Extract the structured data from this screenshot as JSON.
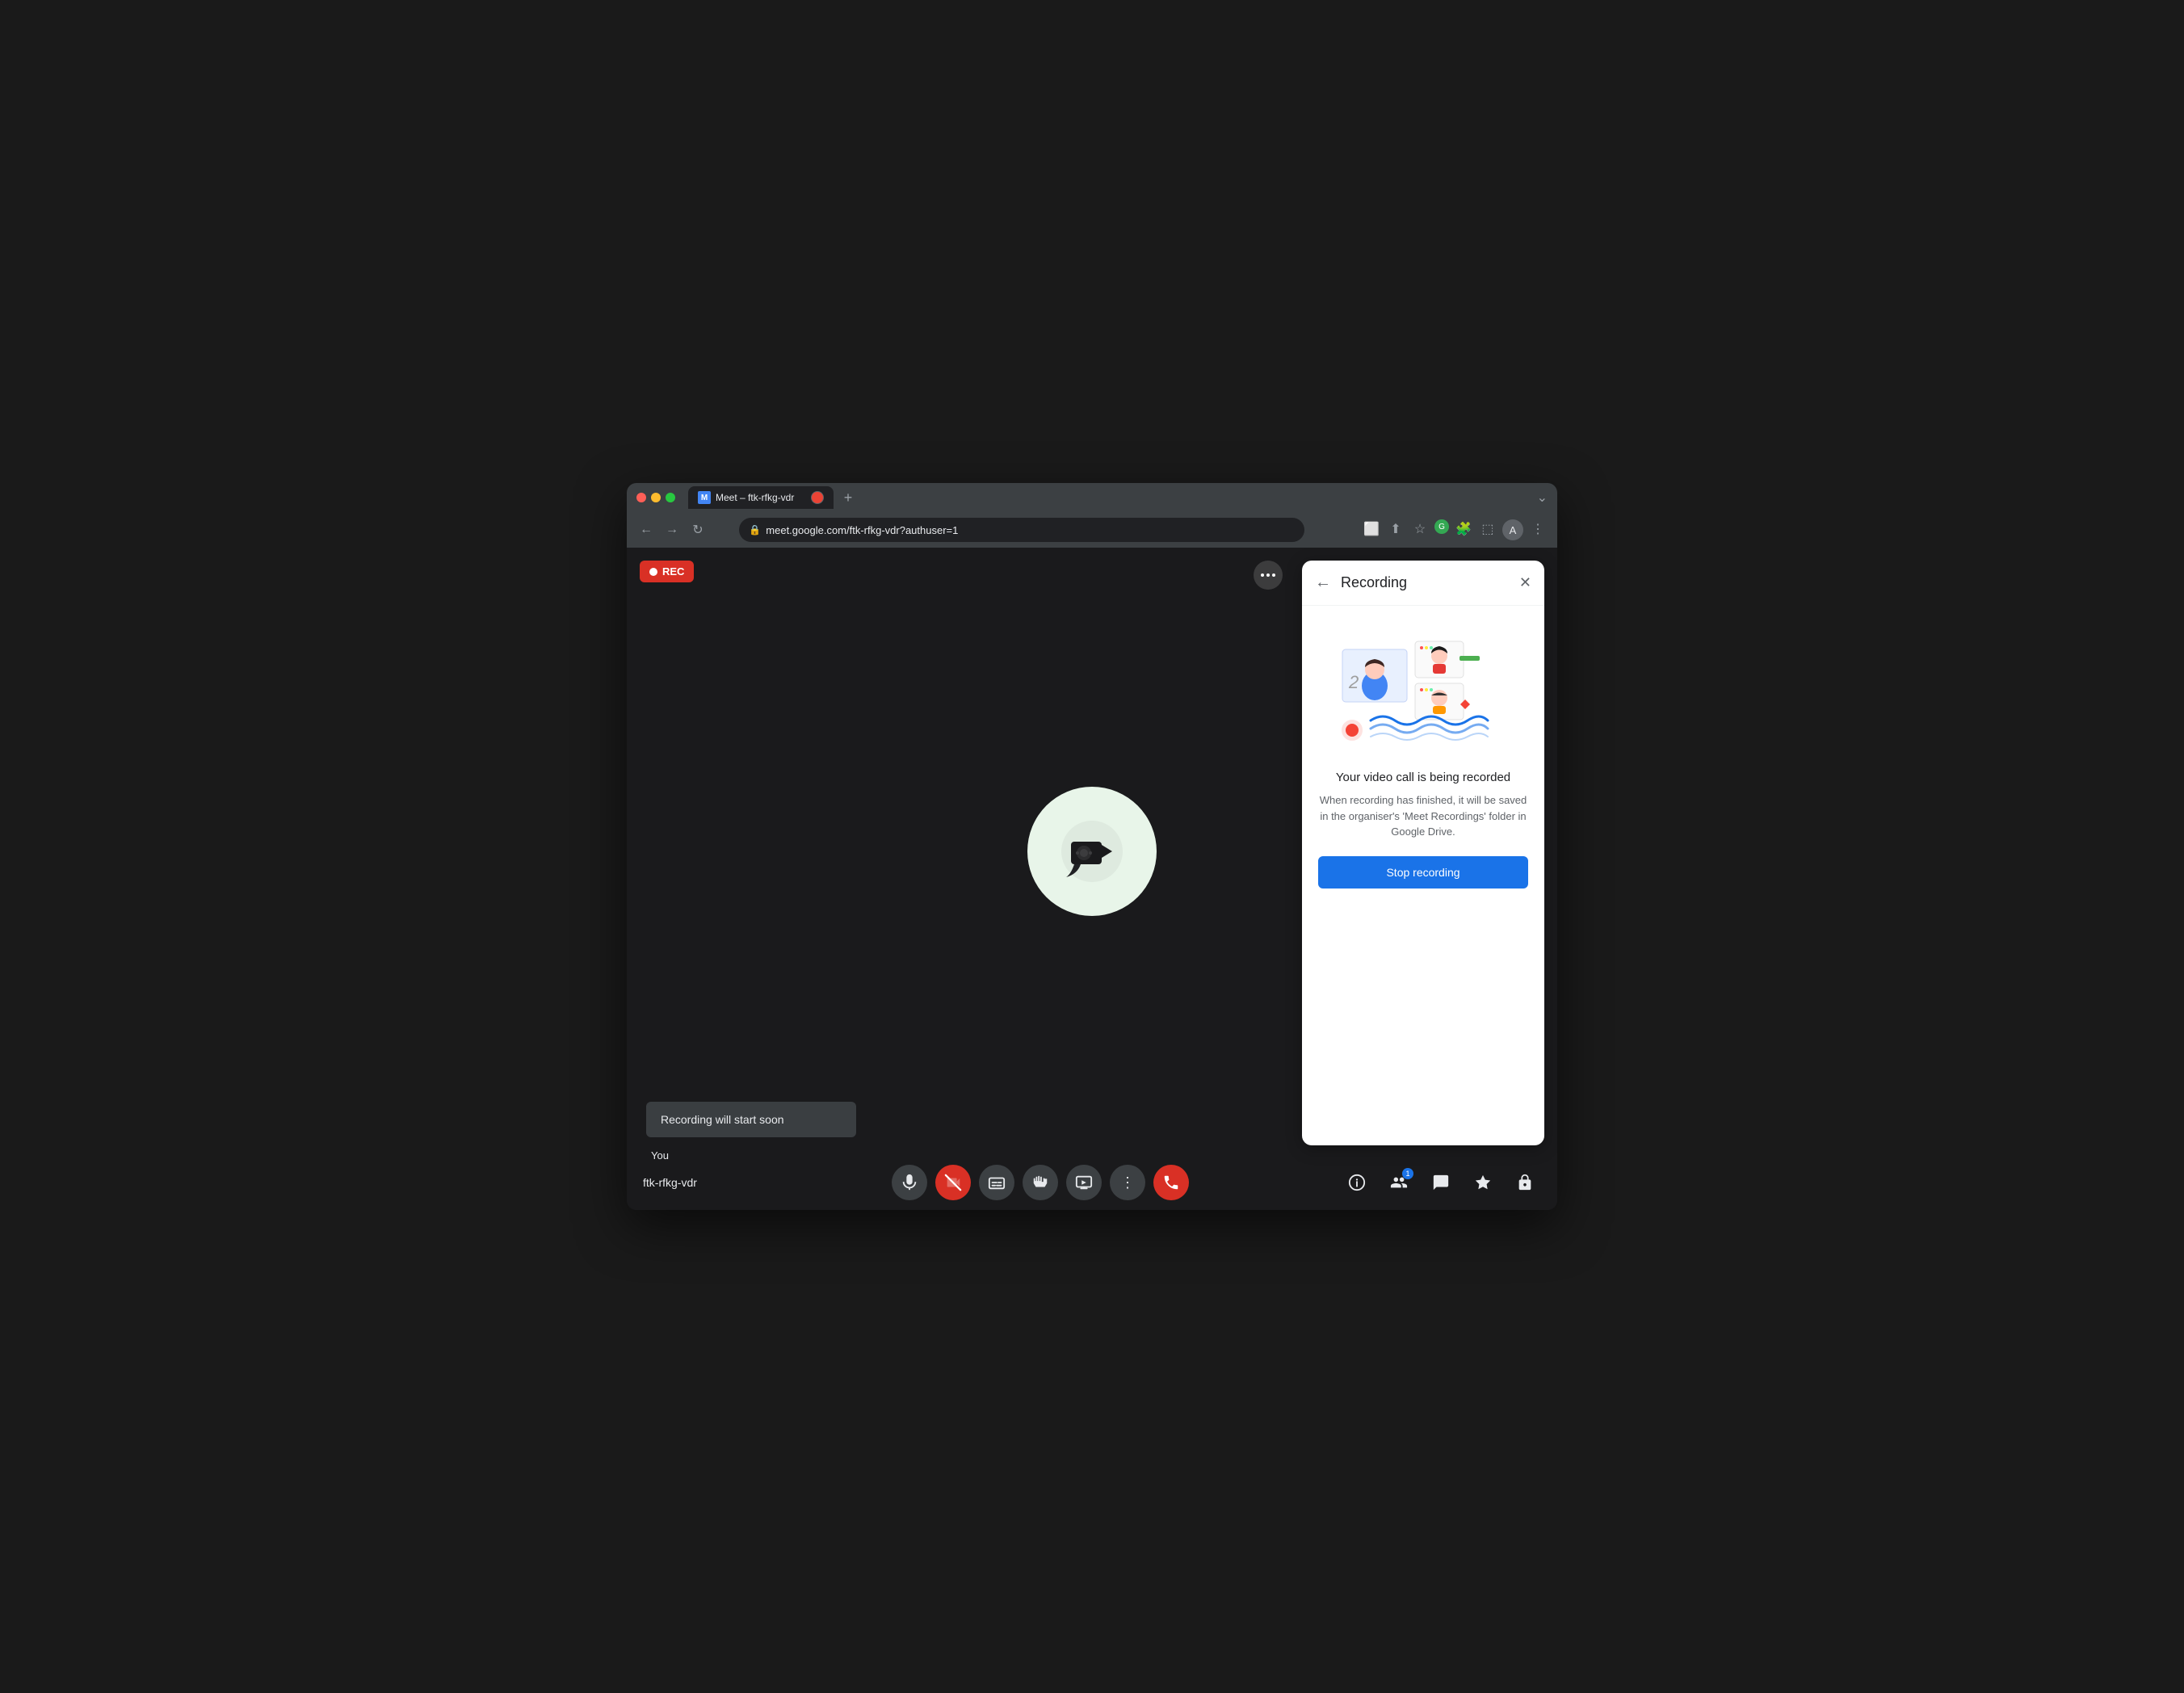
{
  "browser": {
    "tab_title": "Meet – ftk-rfkg-vdr",
    "tab_favicon": "M",
    "url": "meet.google.com/ftk-rfkg-vdr?authuser=1",
    "new_tab_label": "+",
    "collapse_icon": "⌄"
  },
  "nav": {
    "back": "←",
    "forward": "→",
    "refresh": "↻"
  },
  "rec_badge": "REC",
  "meeting": {
    "name": "ftk-rfkg-vdr",
    "you_label": "You"
  },
  "recording_toast": "Recording will start soon",
  "panel": {
    "title": "Recording",
    "back_icon": "←",
    "close_icon": "✕",
    "main_text": "Your video call is being recorded",
    "sub_text": "When recording has finished, it will be saved in the organiser's 'Meet Recordings' folder in Google Drive.",
    "stop_button": "Stop recording"
  },
  "controls": {
    "mic_icon": "🎤",
    "video_off_icon": "📵",
    "captions_icon": "⬜",
    "hand_icon": "✋",
    "present_icon": "⬛",
    "more_icon": "⋮",
    "end_call_icon": "📞"
  },
  "right_controls": {
    "info_icon": "ℹ",
    "people_icon": "👥",
    "chat_icon": "💬",
    "activities_icon": "🌟",
    "safety_icon": "🔒",
    "people_badge": "1"
  },
  "colors": {
    "rec_bg": "#d93025",
    "panel_bg": "#ffffff",
    "stop_btn": "#1a73e8",
    "meet_bg": "#1a1a1c",
    "accent_blue": "#1a73e8"
  }
}
